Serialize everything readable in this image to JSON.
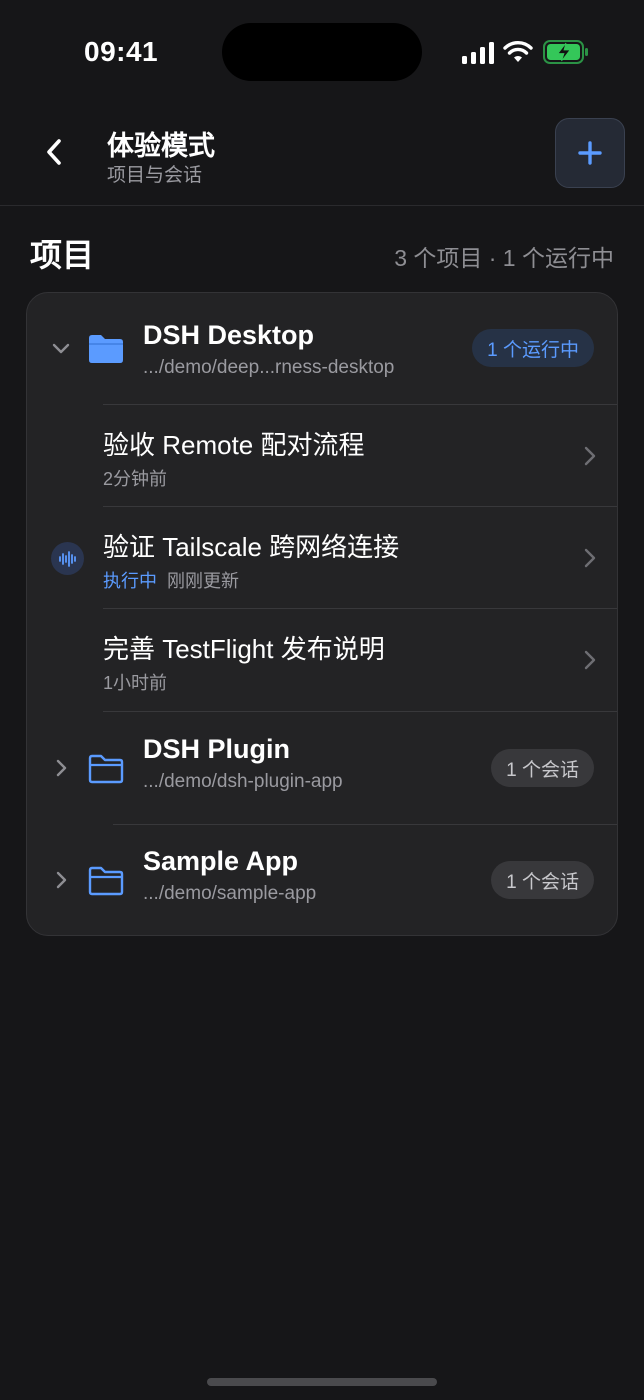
{
  "status_bar": {
    "time": "09:41",
    "battery_color": "#34c759"
  },
  "nav": {
    "title": "体验模式",
    "subtitle": "项目与会话",
    "back_icon": "chevron-left-icon",
    "add_icon": "plus-icon"
  },
  "section": {
    "title": "项目",
    "meta": "3 个项目 · 1 个运行中"
  },
  "projects": [
    {
      "name": "DSH Desktop",
      "path": ".../demo/deep...rness-desktop",
      "badge": "1 个运行中",
      "expanded": true,
      "sessions": [
        {
          "title": "验收 Remote 配对流程",
          "meta": "2分钟前",
          "running": false,
          "status": ""
        },
        {
          "title": "验证 Tailscale 跨网络连接",
          "meta": "刚刚更新",
          "running": true,
          "status": "执行中"
        },
        {
          "title": "完善 TestFlight 发布说明",
          "meta": "1小时前",
          "running": false,
          "status": ""
        }
      ]
    },
    {
      "name": "DSH Plugin",
      "path": ".../demo/dsh-plugin-app",
      "badge": "1 个会话",
      "expanded": false
    },
    {
      "name": "Sample App",
      "path": ".../demo/sample-app",
      "badge": "1 个会话",
      "expanded": false
    }
  ],
  "colors": {
    "accent": "#5b9bff",
    "folder": "#5b9bff",
    "background": "#161618",
    "card": "#232325"
  }
}
